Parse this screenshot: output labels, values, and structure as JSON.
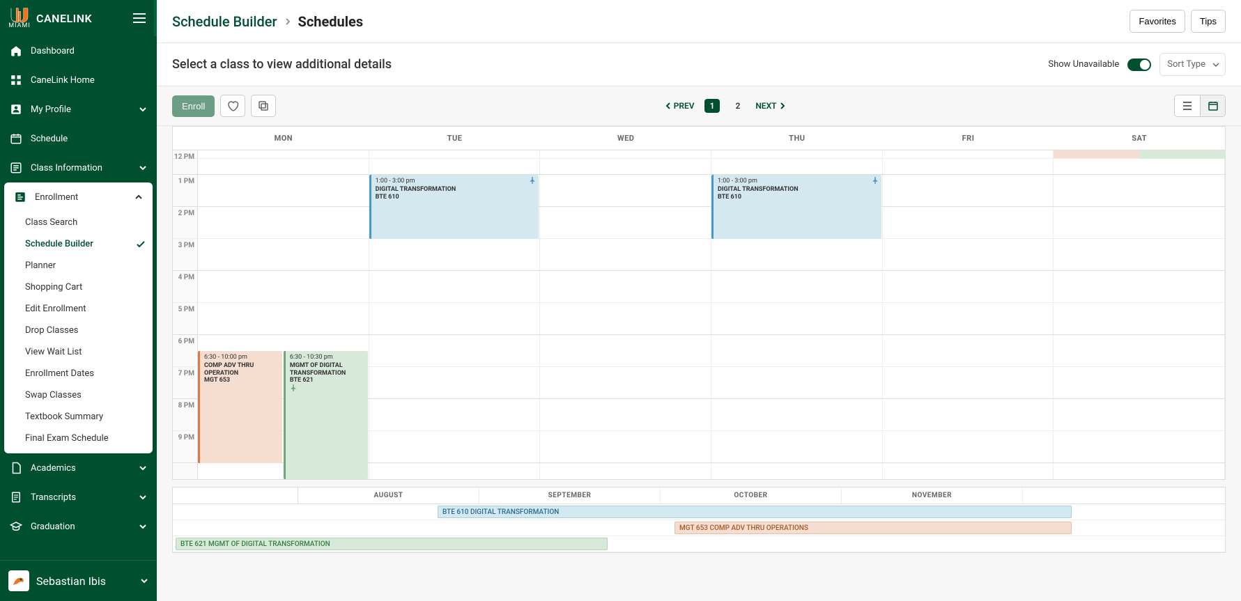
{
  "brand": {
    "name": "CANELINK",
    "sub": "MIAMI"
  },
  "nav": {
    "items": [
      {
        "icon": "home",
        "label": "Dashboard"
      },
      {
        "icon": "grid",
        "label": "CaneLink Home"
      },
      {
        "icon": "person",
        "label": "My Profile",
        "chevron": true
      },
      {
        "icon": "calendar",
        "label": "Schedule"
      },
      {
        "icon": "list",
        "label": "Class Information",
        "chevron": true
      }
    ],
    "enrollment": {
      "label": "Enrollment",
      "items": [
        "Class Search",
        "Schedule Builder",
        "Planner",
        "Shopping Cart",
        "Edit Enrollment",
        "Drop Classes",
        "View Wait List",
        "Enrollment Dates",
        "Swap Classes",
        "Textbook Summary",
        "Final Exam Schedule"
      ],
      "active_index": 1
    },
    "after": [
      {
        "icon": "doc",
        "label": "Academics",
        "chevron": true
      },
      {
        "icon": "file",
        "label": "Transcripts",
        "chevron": true
      },
      {
        "icon": "cap",
        "label": "Graduation",
        "chevron": true
      }
    ]
  },
  "user": {
    "name": "Sebastian Ibis"
  },
  "breadcrumb": {
    "link": "Schedule Builder",
    "current": "Schedules"
  },
  "header_buttons": {
    "fav": "Favorites",
    "tips": "Tips"
  },
  "subheader": {
    "title": "Select a class to view additional details",
    "toggle_label": "Show Unavailable",
    "sort_placeholder": "Sort Type"
  },
  "toolbar": {
    "enroll": "Enroll",
    "prev": "PREV",
    "next": "NEXT",
    "page1": "1",
    "page2": "2"
  },
  "days": [
    "MON",
    "TUE",
    "WED",
    "THU",
    "FRI",
    "SAT"
  ],
  "hours": [
    "12 PM",
    "1 PM",
    "2 PM",
    "3 PM",
    "4 PM",
    "5 PM",
    "6 PM",
    "7 PM",
    "8 PM",
    "9 PM"
  ],
  "events": {
    "tue_digital": {
      "time": "1:00 - 3:00 pm",
      "title": "DIGITAL TRANSFORMATION",
      "code": "BTE 610"
    },
    "thu_digital": {
      "time": "1:00 - 3:00 pm",
      "title": "DIGITAL TRANSFORMATION",
      "code": "BTE 610"
    },
    "mon_comp": {
      "time": "6:30 - 10:00 pm",
      "title": "COMP ADV THRU OPERATION",
      "code": "MGT 653"
    },
    "mon_mgmt": {
      "time": "6:30 - 10:30 pm",
      "title": "MGMT OF DIGITAL TRANSFORMATION",
      "code": "BTE 621"
    }
  },
  "months": [
    "AUGUST",
    "SEPTEMBER",
    "OCTOBER",
    "NOVEMBER"
  ],
  "timeline": {
    "bte610": "BTE 610 DIGITAL TRANSFORMATION",
    "mgt653": "MGT 653 COMP ADV THRU OPERATIONS",
    "bte621": "BTE 621 MGMT OF DIGITAL TRANSFORMATION"
  }
}
